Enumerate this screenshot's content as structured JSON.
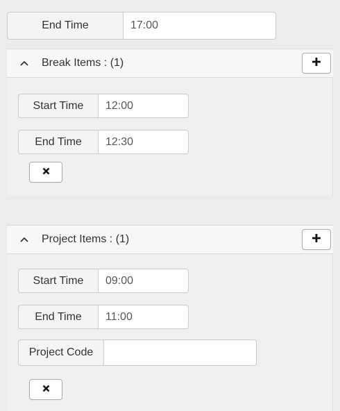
{
  "shift": {
    "end_time_label": "End Time",
    "end_time_value": "17:00"
  },
  "break_items": {
    "header": "Break Items : (1)",
    "add_icon": "plus-icon",
    "collapse_icon": "chevron-up-icon",
    "items": [
      {
        "start_time_label": "Start Time",
        "start_time_value": "12:00",
        "end_time_label": "End Time",
        "end_time_value": "12:30",
        "remove_icon": "times-icon"
      }
    ]
  },
  "project_items": {
    "header": "Project Items : (1)",
    "add_icon": "plus-icon",
    "collapse_icon": "chevron-up-icon",
    "items": [
      {
        "start_time_label": "Start Time",
        "start_time_value": "09:00",
        "end_time_label": "End Time",
        "end_time_value": "11:00",
        "project_code_label": "Project Code",
        "project_code_value": "",
        "remove_icon": "times-icon"
      }
    ]
  }
}
